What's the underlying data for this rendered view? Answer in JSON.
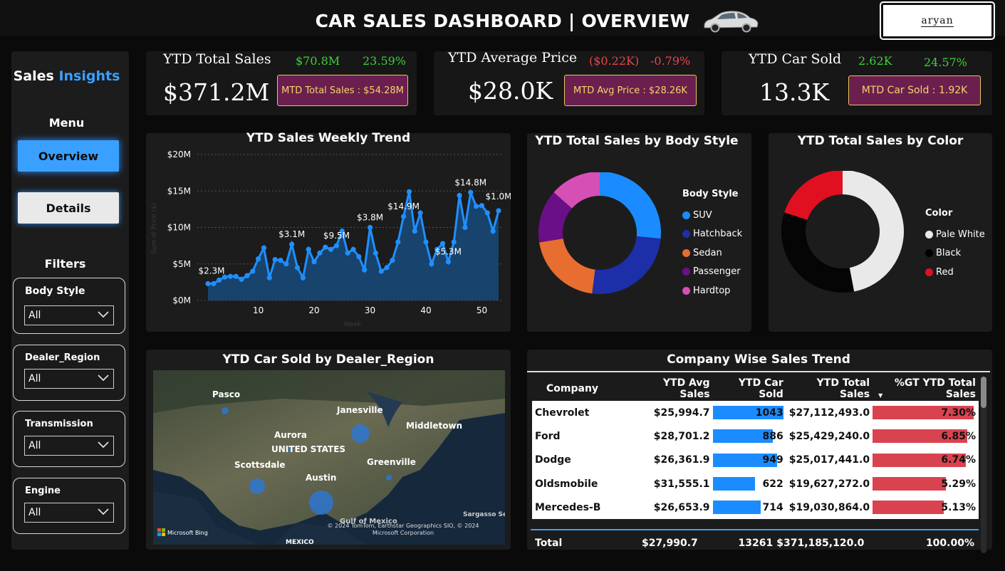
{
  "header": {
    "title": "CAR SALES DASHBOARD | OVERVIEW",
    "logo_text": "aryan"
  },
  "sidebar": {
    "brand_a": "Sales",
    "brand_b": "Insights",
    "menu_heading": "Menu",
    "nav": [
      {
        "label": "Overview",
        "active": true
      },
      {
        "label": "Details",
        "active": false
      }
    ],
    "filters_heading": "Filters",
    "filters": [
      {
        "label": "Body Style",
        "value": "All"
      },
      {
        "label": "Dealer_Region",
        "value": "All"
      },
      {
        "label": "Transmission",
        "value": "All"
      },
      {
        "label": "Engine",
        "value": "All"
      }
    ]
  },
  "kpis": [
    {
      "title": "YTD Total Sales",
      "value": "$371.2M",
      "delta": "$70.8M",
      "pct": "23.59%",
      "trend": "up",
      "mtd": "MTD Total Sales : $54.28M"
    },
    {
      "title": "YTD Average Price",
      "value": "$28.0K",
      "delta": "($0.22K)",
      "pct": "-0.79%",
      "trend": "down",
      "mtd": "MTD Avg Price : $28.26K"
    },
    {
      "title": "YTD Car Sold",
      "value": "13.3K",
      "delta": "2.62K",
      "pct": "24.57%",
      "trend": "up",
      "mtd": "MTD Car Sold : 1.92K"
    }
  ],
  "colors": {
    "accent": "#3aa0ff",
    "positive": "#3bd13b",
    "negative": "#e8454a",
    "mtd_bg": "#6b1f4f",
    "mtd_text": "#f2d56a",
    "line": "#1f8fff",
    "area": "#174a7a"
  },
  "chart_data": [
    {
      "type": "area",
      "title": "YTD Sales Weekly Trend",
      "xlabel": "Week",
      "ylabel": "Sum of Price ($)",
      "ylim": [
        0,
        20
      ],
      "yticks": [
        "$0M",
        "$5M",
        "$10M",
        "$15M",
        "$20M"
      ],
      "xticks": [
        10,
        20,
        30,
        40,
        50
      ],
      "grid": true,
      "x": [
        1,
        2,
        3,
        4,
        5,
        6,
        7,
        8,
        9,
        10,
        11,
        12,
        13,
        14,
        15,
        16,
        17,
        18,
        19,
        20,
        21,
        22,
        23,
        24,
        25,
        26,
        27,
        28,
        29,
        30,
        31,
        32,
        33,
        34,
        35,
        36,
        37,
        38,
        39,
        40,
        41,
        42,
        43,
        44,
        45,
        46,
        47,
        48,
        49,
        50,
        51,
        52,
        53
      ],
      "values": [
        2.3,
        2.3,
        2.8,
        3.2,
        3.3,
        3.3,
        2.9,
        3.4,
        4.0,
        5.7,
        7.2,
        3.1,
        5.6,
        5.5,
        5.0,
        7.7,
        4.5,
        3.1,
        7.0,
        5.3,
        6.5,
        7.3,
        7.0,
        7.5,
        9.5,
        6.5,
        7.0,
        6.0,
        4.2,
        10.0,
        6.5,
        4.0,
        4.5,
        5.5,
        8.0,
        11.5,
        14.9,
        9.5,
        12.0,
        8.0,
        5.0,
        7.0,
        7.8,
        5.3,
        8.0,
        14.4,
        10.0,
        14.8,
        12.9,
        13.0,
        12.0,
        9.5,
        12.3,
        1.0
      ],
      "data_labels": [
        {
          "x": 1,
          "label": "$2.3M"
        },
        {
          "x": 16,
          "label": "$3.1M"
        },
        {
          "x": 24,
          "label": "$9.5M"
        },
        {
          "x": 30,
          "label": "$3.8M"
        },
        {
          "x": 36,
          "label": "$14.9M"
        },
        {
          "x": 44,
          "label": "$5.3M"
        },
        {
          "x": 48,
          "label": "$14.8M"
        },
        {
          "x": 53,
          "label": "$1.0M"
        }
      ]
    },
    {
      "type": "pie",
      "title": "YTD Total Sales by Body Style",
      "legend_title": "Body Style",
      "categories": [
        "SUV",
        "Hatchback",
        "Sedan",
        "Passenger",
        "Hardtop"
      ],
      "values": [
        26.5,
        25.5,
        20.5,
        14.0,
        13.5
      ],
      "colors": [
        "#1a8cff",
        "#1c2fa8",
        "#e86d31",
        "#6a0f87",
        "#d64fb5"
      ]
    },
    {
      "type": "pie",
      "title": "YTD Total Sales by Color",
      "legend_title": "Color",
      "categories": [
        "Pale White",
        "Black",
        "Red"
      ],
      "values": [
        47,
        33,
        20
      ],
      "colors": [
        "#e9e9e9",
        "#050505",
        "#e01020"
      ]
    }
  ],
  "map": {
    "title": "YTD Car Sold by Dealer_Region",
    "labels": [
      "Pasco",
      "Janesville",
      "Aurora",
      "Middletown",
      "UNITED STATES",
      "Scottsdale",
      "Greenville",
      "Austin",
      "Sargasso Sea",
      "Gulf of Mexico",
      "MEXICO"
    ],
    "attribution": "© 2024 TomTom, Earthstar Geographics SIO, © 2024 Microsoft Corporation",
    "provider": "Microsoft Bing"
  },
  "table": {
    "title": "Company Wise Sales Trend",
    "columns": [
      "Company",
      "YTD Avg Sales",
      "YTD Car Sold",
      "YTD Total Sales",
      "%GT YTD Total Sales"
    ],
    "rows": [
      {
        "company": "Chevrolet",
        "avg": "$25,994.7",
        "sold": "1043",
        "sold_n": 1043,
        "total": "$27,112,493.0",
        "pct": "7.30%",
        "pct_n": 7.3
      },
      {
        "company": "Ford",
        "avg": "$28,701.2",
        "sold": "886",
        "sold_n": 886,
        "total": "$25,429,240.0",
        "pct": "6.85%",
        "pct_n": 6.85
      },
      {
        "company": "Dodge",
        "avg": "$26,361.9",
        "sold": "949",
        "sold_n": 949,
        "total": "$25,017,441.0",
        "pct": "6.74%",
        "pct_n": 6.74
      },
      {
        "company": "Oldsmobile",
        "avg": "$31,555.1",
        "sold": "622",
        "sold_n": 622,
        "total": "$19,627,272.0",
        "pct": "5.29%",
        "pct_n": 5.29
      },
      {
        "company": "Mercedes-B",
        "avg": "$26,653.9",
        "sold": "714",
        "sold_n": 714,
        "total": "$19,030,864.0",
        "pct": "5.13%",
        "pct_n": 5.13
      }
    ],
    "total": {
      "label": "Total",
      "avg": "$27,990.7",
      "sold": "13261",
      "total": "$371,185,120.0",
      "pct": "100.00%"
    }
  }
}
